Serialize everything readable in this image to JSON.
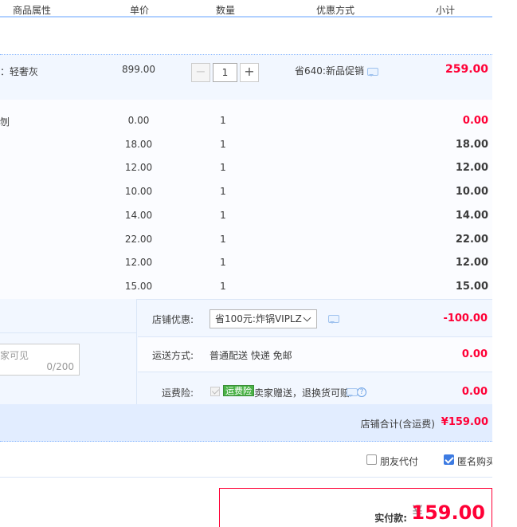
{
  "header": {
    "col_attr": "商品属性",
    "col_price": "单价",
    "col_qty": "数量",
    "col_promo": "优惠方式",
    "col_subtotal": "小计"
  },
  "main_item": {
    "attr": "：轻奢灰",
    "price": "899.00",
    "quantity": "1",
    "promo": "省640:新品促销",
    "subtotal": "259.00",
    "minus_icon": "minus-icon",
    "plus_icon": "plus-icon"
  },
  "sub_items": [
    {
      "attr": "刎",
      "price": "0.00",
      "qty": "1",
      "subtotal": "0.00",
      "red": true
    },
    {
      "attr": "",
      "price": "18.00",
      "qty": "1",
      "subtotal": "18.00",
      "red": false
    },
    {
      "attr": "",
      "price": "12.00",
      "qty": "1",
      "subtotal": "12.00",
      "red": false
    },
    {
      "attr": "",
      "price": "10.00",
      "qty": "1",
      "subtotal": "10.00",
      "red": false
    },
    {
      "attr": "",
      "price": "14.00",
      "qty": "1",
      "subtotal": "14.00",
      "red": false
    },
    {
      "attr": "",
      "price": "22.00",
      "qty": "1",
      "subtotal": "22.00",
      "red": false
    },
    {
      "attr": "",
      "price": "12.00",
      "qty": "1",
      "subtotal": "12.00",
      "red": false
    },
    {
      "attr": "",
      "price": "15.00",
      "qty": "1",
      "subtotal": "15.00",
      "red": false
    }
  ],
  "memo": {
    "placeholder": "家可见",
    "count": "0/200"
  },
  "store_coupon": {
    "label": "店铺优惠:",
    "selected": "省100元:炸锅VIPLZ",
    "amount": "-100.00"
  },
  "shipping": {
    "label": "运送方式:",
    "value": "普通配送 快递 免邮",
    "amount": "0.00"
  },
  "insurance": {
    "label": "运费险:",
    "badge": "运费险",
    "text": "卖家赠送，退换货可赔",
    "help": "?",
    "amount": "0.00"
  },
  "store_total": {
    "label": "店铺合计(含运费)",
    "value": "¥159.00"
  },
  "options": {
    "friend_pay": "朋友代付",
    "anonymous": "匿名购买"
  },
  "payment": {
    "label": "实付款:",
    "yen": "¥",
    "amount": "159.00"
  },
  "colors": {
    "accent_red": "#ff0036",
    "accent_blue": "#3d7be2",
    "row_bg": "#f2f7ff"
  }
}
